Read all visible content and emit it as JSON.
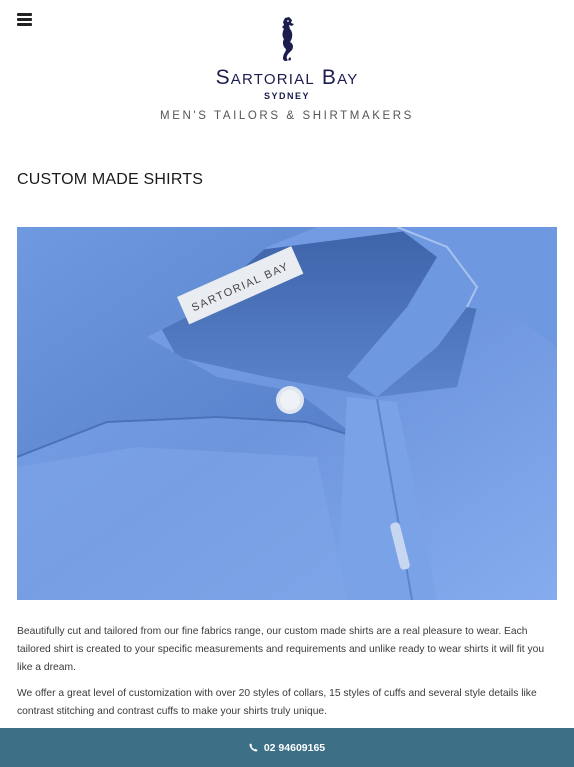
{
  "header": {
    "menu_icon": "hamburger-menu-icon",
    "brand_name": "Sartorial Bay",
    "brand_city": "SYDNEY",
    "tagline": "MEN'S TAILORS & SHIRTMAKERS"
  },
  "main": {
    "title": "CUSTOM MADE SHIRTS",
    "hero_label_text": "SARTORIAL BAY",
    "paragraphs": [
      "Beautifully cut and tailored from our fine fabrics range, our custom made shirts are a real pleasure to wear. Each tailored shirt is created to your specific measurements and requirements and unlike ready to wear shirts it will fit you like a dream.",
      "We offer a great level of customization with over 20 styles of collars, 15 styles of cuffs and several style details like contrast stitching and contrast cuffs to make your shirts truly unique."
    ]
  },
  "call_bar": {
    "icon": "phone-icon",
    "phone": "02 94609165"
  },
  "colors": {
    "brand_navy": "#1c1c4e",
    "call_bar_bg": "#3d6f86",
    "shirt_blue": "#6d95dc"
  }
}
